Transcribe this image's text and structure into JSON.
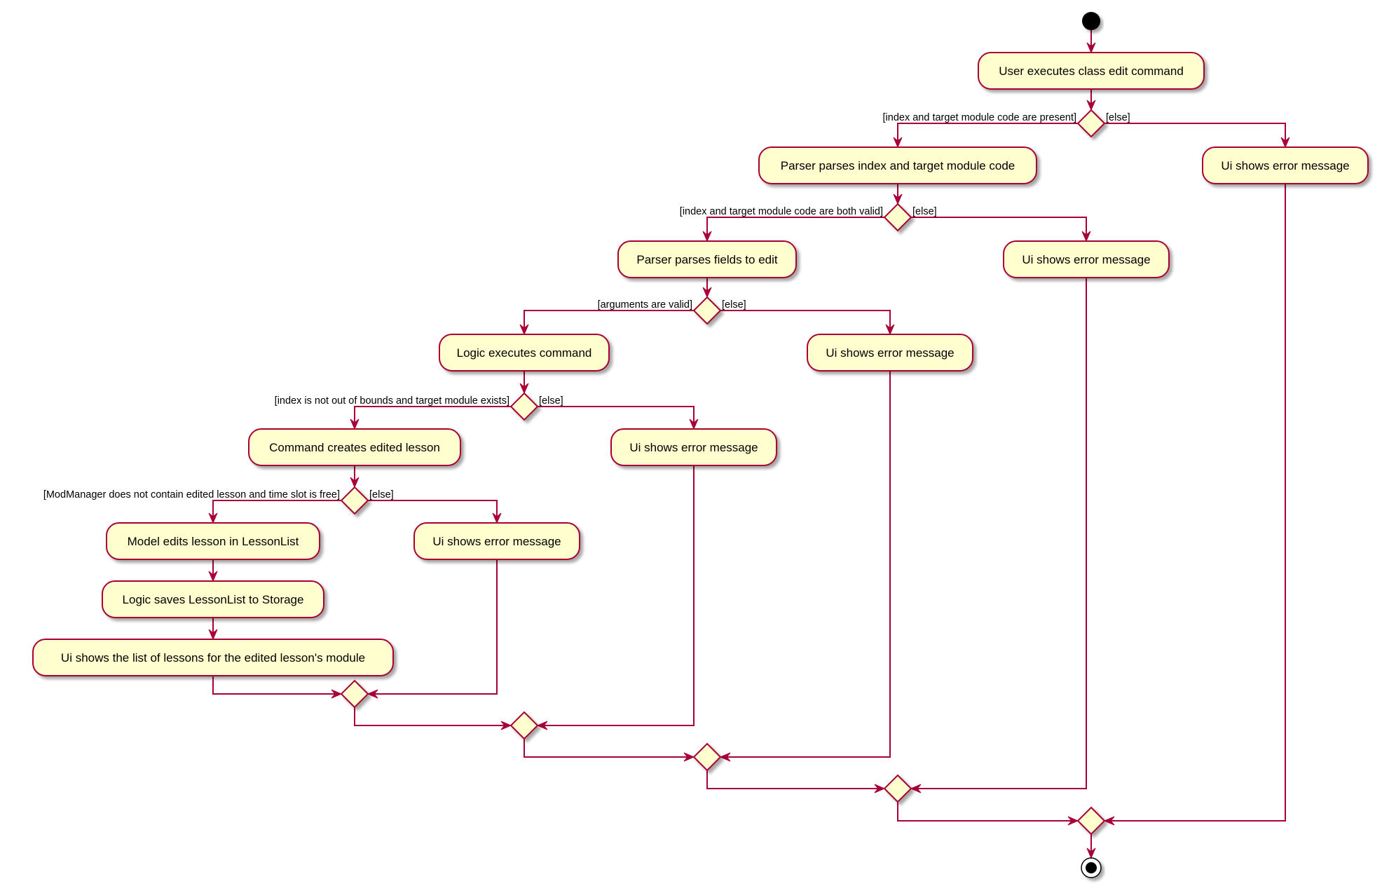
{
  "diagram": {
    "type": "activity",
    "colors": {
      "activity_fill": "#FEFECE",
      "border": "#A80036",
      "start_end": "#000000"
    },
    "nodes": {
      "start": {
        "kind": "start"
      },
      "user_exec": {
        "kind": "activity",
        "label": "User executes class edit command"
      },
      "d1": {
        "kind": "decision"
      },
      "parser_index": {
        "kind": "activity",
        "label": "Parser parses index and target module code"
      },
      "err1": {
        "kind": "activity",
        "label": "Ui shows error message"
      },
      "d2": {
        "kind": "decision"
      },
      "parser_fields": {
        "kind": "activity",
        "label": "Parser parses fields to edit"
      },
      "err2": {
        "kind": "activity",
        "label": "Ui shows error message"
      },
      "d3": {
        "kind": "decision"
      },
      "logic_exec": {
        "kind": "activity",
        "label": "Logic executes command"
      },
      "err3": {
        "kind": "activity",
        "label": "Ui shows error message"
      },
      "d4": {
        "kind": "decision"
      },
      "cmd_create": {
        "kind": "activity",
        "label": "Command creates edited lesson"
      },
      "err4": {
        "kind": "activity",
        "label": "Ui shows error message"
      },
      "d5": {
        "kind": "decision"
      },
      "model_edit": {
        "kind": "activity",
        "label": "Model edits lesson in LessonList"
      },
      "err5": {
        "kind": "activity",
        "label": "Ui shows error message"
      },
      "logic_save": {
        "kind": "activity",
        "label": "Logic saves LessonList to Storage"
      },
      "ui_list": {
        "kind": "activity",
        "label": "Ui shows the list of lessons for the edited lesson's module"
      },
      "m5": {
        "kind": "merge"
      },
      "m4": {
        "kind": "merge"
      },
      "m3": {
        "kind": "merge"
      },
      "m2": {
        "kind": "merge"
      },
      "m1": {
        "kind": "merge"
      },
      "end": {
        "kind": "end"
      }
    },
    "guards": {
      "d1_yes": "[index and target module code are present]",
      "d1_no": "[else]",
      "d2_yes": "[index and target module code are both valid]",
      "d2_no": "[else]",
      "d3_yes": "[arguments are valid]",
      "d3_no": "[else]",
      "d4_yes": "[index is not out of bounds and target module exists]",
      "d4_no": "[else]",
      "d5_yes": "[ModManager does not contain edited lesson and time slot is free]",
      "d5_no": "[else]"
    },
    "edges": [
      [
        "start",
        "user_exec"
      ],
      [
        "user_exec",
        "d1"
      ],
      [
        "d1",
        "parser_index",
        "d1_yes"
      ],
      [
        "d1",
        "err1",
        "d1_no"
      ],
      [
        "parser_index",
        "d2"
      ],
      [
        "d2",
        "parser_fields",
        "d2_yes"
      ],
      [
        "d2",
        "err2",
        "d2_no"
      ],
      [
        "parser_fields",
        "d3"
      ],
      [
        "d3",
        "logic_exec",
        "d3_yes"
      ],
      [
        "d3",
        "err3",
        "d3_no"
      ],
      [
        "logic_exec",
        "d4"
      ],
      [
        "d4",
        "cmd_create",
        "d4_yes"
      ],
      [
        "d4",
        "err4",
        "d4_no"
      ],
      [
        "cmd_create",
        "d5"
      ],
      [
        "d5",
        "model_edit",
        "d5_yes"
      ],
      [
        "d5",
        "err5",
        "d5_no"
      ],
      [
        "model_edit",
        "logic_save"
      ],
      [
        "logic_save",
        "ui_list"
      ],
      [
        "ui_list",
        "m5"
      ],
      [
        "err5",
        "m5"
      ],
      [
        "m5",
        "m4"
      ],
      [
        "err4",
        "m4"
      ],
      [
        "m4",
        "m3"
      ],
      [
        "err3",
        "m3"
      ],
      [
        "m3",
        "m2"
      ],
      [
        "err2",
        "m2"
      ],
      [
        "m2",
        "m1"
      ],
      [
        "err1",
        "m1"
      ],
      [
        "m1",
        "end"
      ]
    ]
  }
}
